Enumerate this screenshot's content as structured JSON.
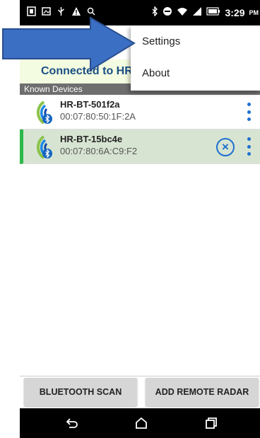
{
  "status_bar": {
    "time": "3:29",
    "time_suffix": "PM",
    "left_icons": [
      "notification-icon",
      "image-icon",
      "usb-icon",
      "warning-icon",
      "search-icon"
    ],
    "right_icons": [
      "bluetooth-icon",
      "do-not-disturb-icon",
      "wifi-icon",
      "signal-icon",
      "battery-icon"
    ]
  },
  "connection": {
    "text": "Connected to HR"
  },
  "section": {
    "title": "Known Devices"
  },
  "devices": [
    {
      "name": "HR-BT-501f2a",
      "address": "00:07:80:50:1F:2A",
      "selected": false
    },
    {
      "name": "HR-BT-15bc4e",
      "address": "00:07:80:6A:C9:F2",
      "selected": true
    }
  ],
  "buttons": {
    "scan": "BLUETOOTH SCAN",
    "remote": "ADD REMOTE RADAR"
  },
  "menu": {
    "items": [
      "Settings",
      "About"
    ]
  },
  "nav": {
    "icons": [
      "back-icon",
      "home-icon",
      "recents-icon"
    ]
  },
  "colors": {
    "accent": "#1d6fd0",
    "selected_bar": "#2db84a",
    "arrow": "#3b6fc4"
  }
}
